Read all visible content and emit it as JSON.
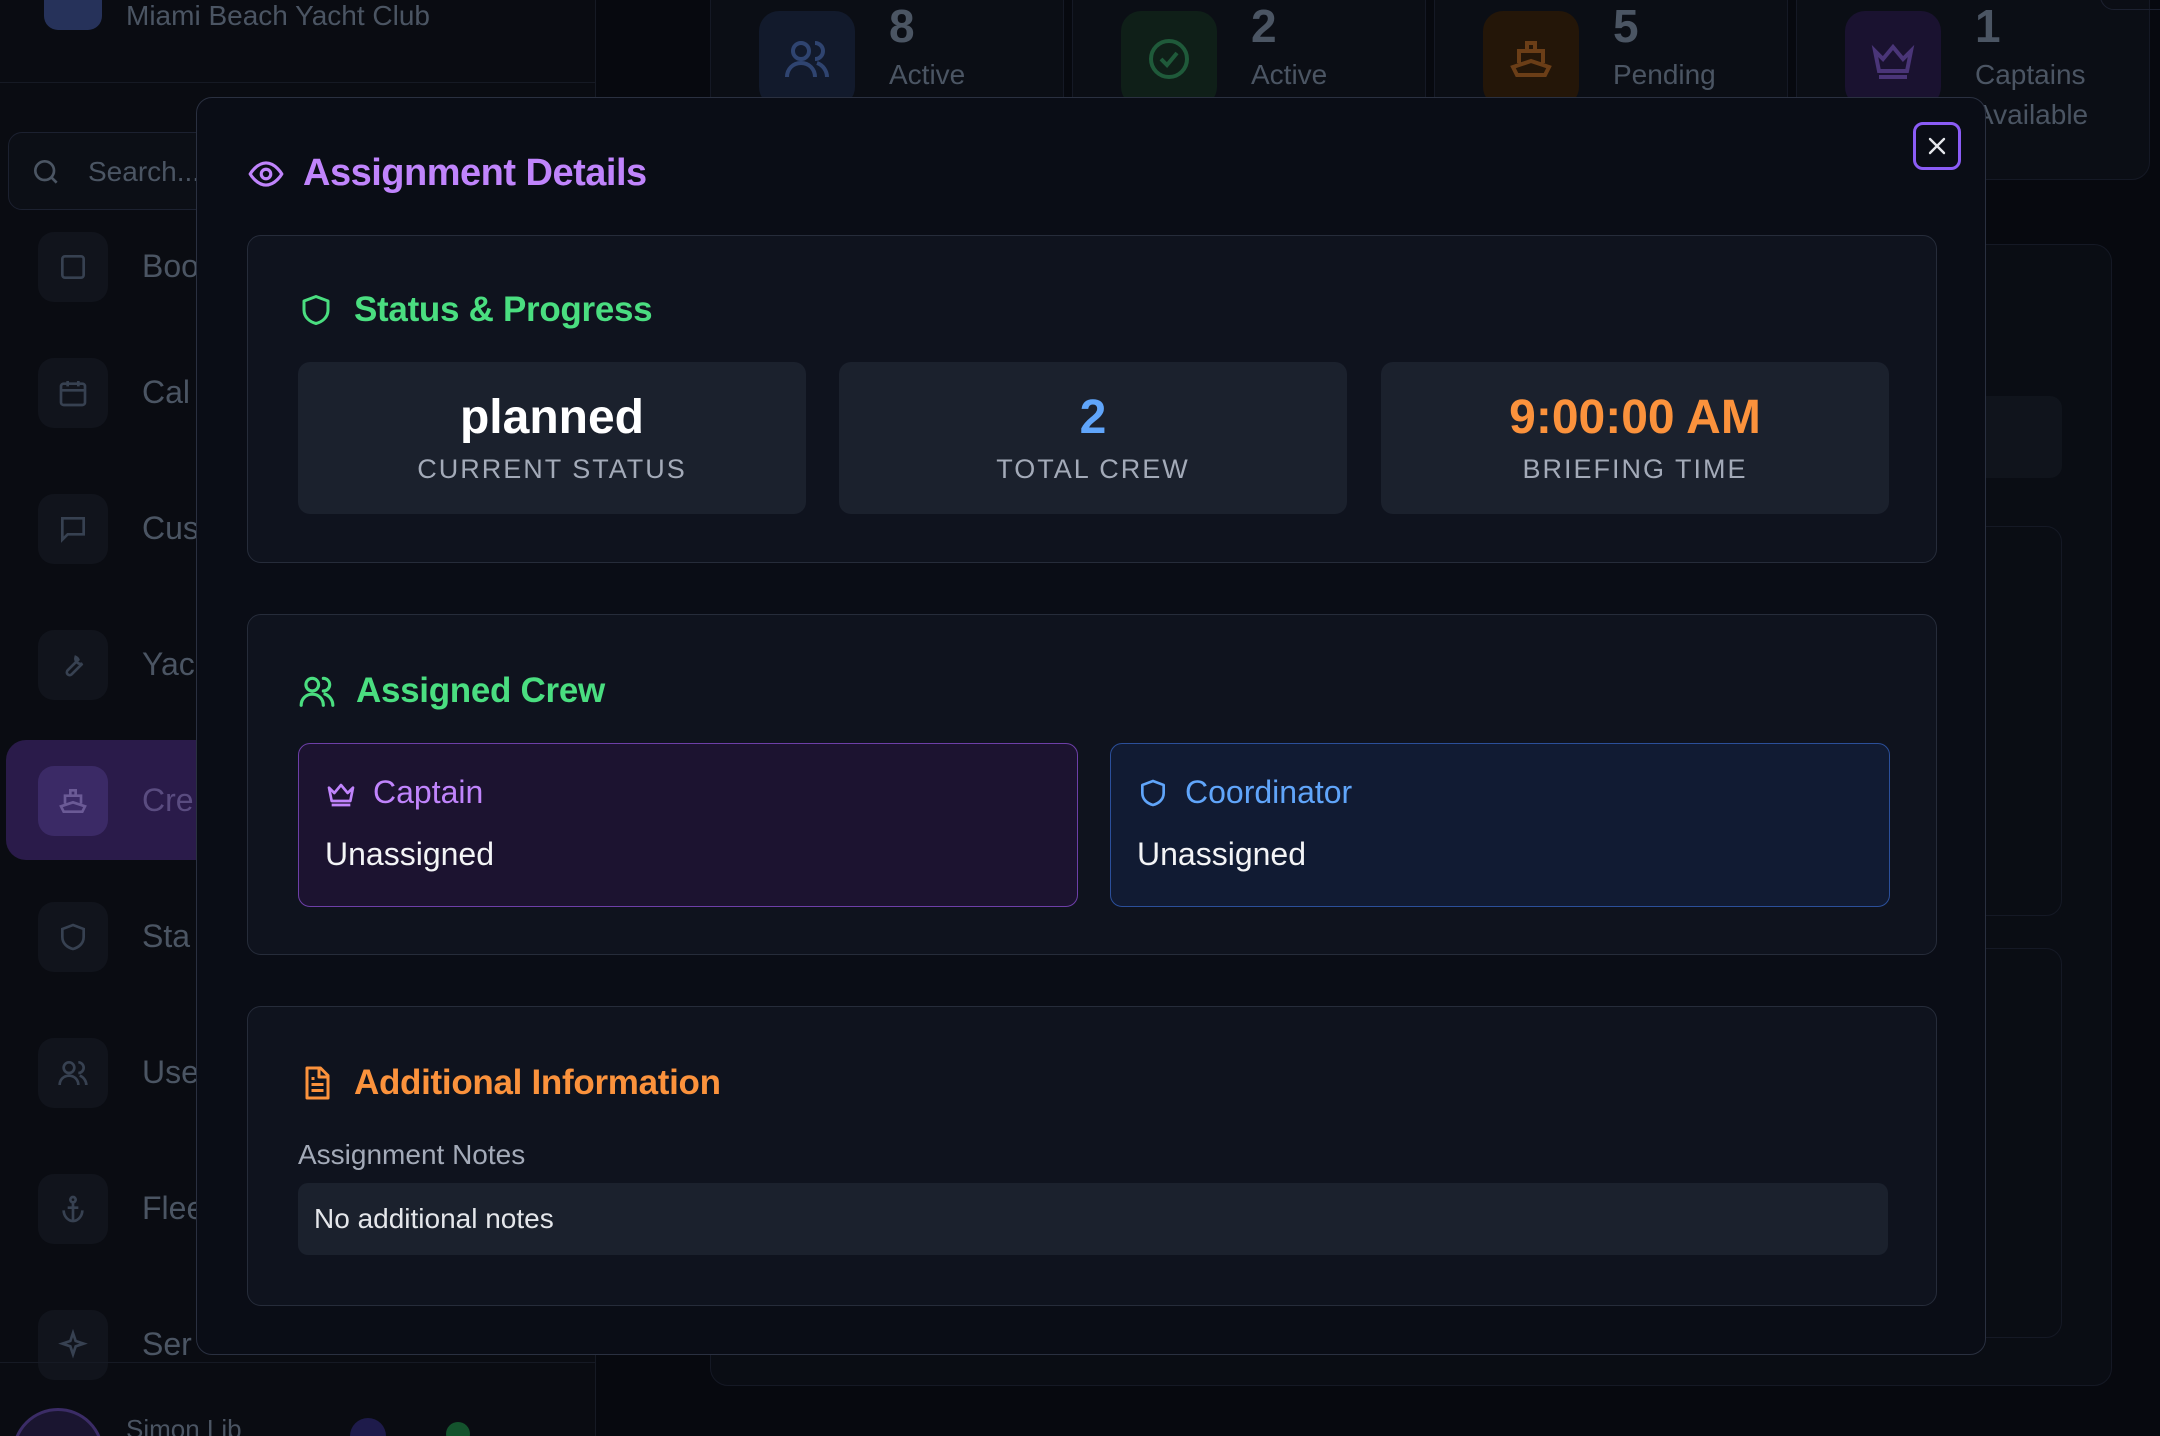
{
  "background": {
    "brand_name": "Miami Beach Yacht Club",
    "search_placeholder": "Search...",
    "nav_items": [
      {
        "label": "Boo",
        "icon": "square-icon"
      },
      {
        "label": "Cal",
        "icon": "calendar-icon"
      },
      {
        "label": "Cus",
        "icon": "message-icon"
      },
      {
        "label": "Yac",
        "icon": "wrench-icon"
      },
      {
        "label": "Cre",
        "icon": "ship-icon"
      },
      {
        "label": "Sta",
        "icon": "shield-icon"
      },
      {
        "label": "Use",
        "icon": "users-icon"
      },
      {
        "label": "Flee",
        "icon": "anchor-icon"
      },
      {
        "label": "Ser",
        "icon": "sparkle-icon"
      }
    ],
    "user_name": "Simon Lib",
    "stats": [
      {
        "number": "8",
        "label": "Active",
        "icon": "users-icon"
      },
      {
        "number": "2",
        "label": "Active",
        "icon": "check-circle-icon"
      },
      {
        "number": "5",
        "label": "Pending",
        "icon": "ship-icon"
      },
      {
        "number": "1",
        "label": "Captains\nAvailable",
        "icon": "crown-icon"
      }
    ]
  },
  "modal": {
    "title": "Assignment Details",
    "status_section": {
      "title": "Status & Progress",
      "current_status": {
        "value": "planned",
        "label": "CURRENT STATUS"
      },
      "total_crew": {
        "value": "2",
        "label": "TOTAL CREW"
      },
      "briefing_time": {
        "value": "9:00:00 AM",
        "label": "BRIEFING TIME"
      }
    },
    "crew_section": {
      "title": "Assigned Crew",
      "captain": {
        "role": "Captain",
        "name": "Unassigned"
      },
      "coordinator": {
        "role": "Coordinator",
        "name": "Unassigned"
      }
    },
    "info_section": {
      "title": "Additional Information",
      "notes_label": "Assignment Notes",
      "notes_value": "No additional notes"
    }
  },
  "colors": {
    "purple_accent": "#c084fc",
    "green_accent": "#4ade80",
    "blue_accent": "#60a5fa",
    "orange_accent": "#fb923c"
  }
}
